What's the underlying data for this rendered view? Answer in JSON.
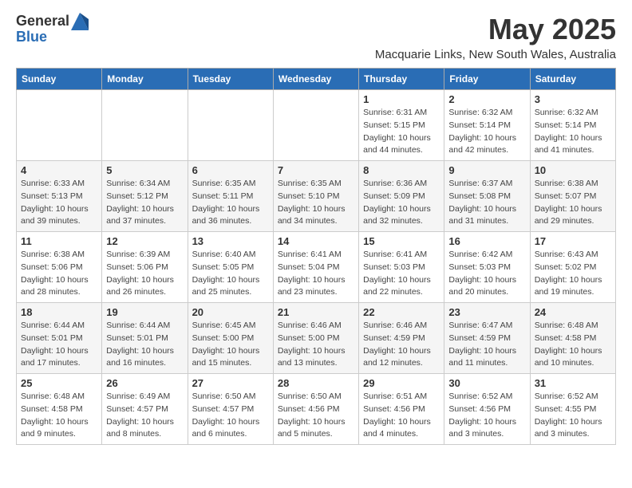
{
  "header": {
    "logo_line1": "General",
    "logo_line2": "Blue",
    "title": "May 2025",
    "subtitle": "Macquarie Links, New South Wales, Australia"
  },
  "days_of_week": [
    "Sunday",
    "Monday",
    "Tuesday",
    "Wednesday",
    "Thursday",
    "Friday",
    "Saturday"
  ],
  "weeks": [
    [
      {
        "day": "",
        "info": ""
      },
      {
        "day": "",
        "info": ""
      },
      {
        "day": "",
        "info": ""
      },
      {
        "day": "",
        "info": ""
      },
      {
        "day": "1",
        "info": "Sunrise: 6:31 AM\nSunset: 5:15 PM\nDaylight: 10 hours\nand 44 minutes."
      },
      {
        "day": "2",
        "info": "Sunrise: 6:32 AM\nSunset: 5:14 PM\nDaylight: 10 hours\nand 42 minutes."
      },
      {
        "day": "3",
        "info": "Sunrise: 6:32 AM\nSunset: 5:14 PM\nDaylight: 10 hours\nand 41 minutes."
      }
    ],
    [
      {
        "day": "4",
        "info": "Sunrise: 6:33 AM\nSunset: 5:13 PM\nDaylight: 10 hours\nand 39 minutes."
      },
      {
        "day": "5",
        "info": "Sunrise: 6:34 AM\nSunset: 5:12 PM\nDaylight: 10 hours\nand 37 minutes."
      },
      {
        "day": "6",
        "info": "Sunrise: 6:35 AM\nSunset: 5:11 PM\nDaylight: 10 hours\nand 36 minutes."
      },
      {
        "day": "7",
        "info": "Sunrise: 6:35 AM\nSunset: 5:10 PM\nDaylight: 10 hours\nand 34 minutes."
      },
      {
        "day": "8",
        "info": "Sunrise: 6:36 AM\nSunset: 5:09 PM\nDaylight: 10 hours\nand 32 minutes."
      },
      {
        "day": "9",
        "info": "Sunrise: 6:37 AM\nSunset: 5:08 PM\nDaylight: 10 hours\nand 31 minutes."
      },
      {
        "day": "10",
        "info": "Sunrise: 6:38 AM\nSunset: 5:07 PM\nDaylight: 10 hours\nand 29 minutes."
      }
    ],
    [
      {
        "day": "11",
        "info": "Sunrise: 6:38 AM\nSunset: 5:06 PM\nDaylight: 10 hours\nand 28 minutes."
      },
      {
        "day": "12",
        "info": "Sunrise: 6:39 AM\nSunset: 5:06 PM\nDaylight: 10 hours\nand 26 minutes."
      },
      {
        "day": "13",
        "info": "Sunrise: 6:40 AM\nSunset: 5:05 PM\nDaylight: 10 hours\nand 25 minutes."
      },
      {
        "day": "14",
        "info": "Sunrise: 6:41 AM\nSunset: 5:04 PM\nDaylight: 10 hours\nand 23 minutes."
      },
      {
        "day": "15",
        "info": "Sunrise: 6:41 AM\nSunset: 5:03 PM\nDaylight: 10 hours\nand 22 minutes."
      },
      {
        "day": "16",
        "info": "Sunrise: 6:42 AM\nSunset: 5:03 PM\nDaylight: 10 hours\nand 20 minutes."
      },
      {
        "day": "17",
        "info": "Sunrise: 6:43 AM\nSunset: 5:02 PM\nDaylight: 10 hours\nand 19 minutes."
      }
    ],
    [
      {
        "day": "18",
        "info": "Sunrise: 6:44 AM\nSunset: 5:01 PM\nDaylight: 10 hours\nand 17 minutes."
      },
      {
        "day": "19",
        "info": "Sunrise: 6:44 AM\nSunset: 5:01 PM\nDaylight: 10 hours\nand 16 minutes."
      },
      {
        "day": "20",
        "info": "Sunrise: 6:45 AM\nSunset: 5:00 PM\nDaylight: 10 hours\nand 15 minutes."
      },
      {
        "day": "21",
        "info": "Sunrise: 6:46 AM\nSunset: 5:00 PM\nDaylight: 10 hours\nand 13 minutes."
      },
      {
        "day": "22",
        "info": "Sunrise: 6:46 AM\nSunset: 4:59 PM\nDaylight: 10 hours\nand 12 minutes."
      },
      {
        "day": "23",
        "info": "Sunrise: 6:47 AM\nSunset: 4:59 PM\nDaylight: 10 hours\nand 11 minutes."
      },
      {
        "day": "24",
        "info": "Sunrise: 6:48 AM\nSunset: 4:58 PM\nDaylight: 10 hours\nand 10 minutes."
      }
    ],
    [
      {
        "day": "25",
        "info": "Sunrise: 6:48 AM\nSunset: 4:58 PM\nDaylight: 10 hours\nand 9 minutes."
      },
      {
        "day": "26",
        "info": "Sunrise: 6:49 AM\nSunset: 4:57 PM\nDaylight: 10 hours\nand 8 minutes."
      },
      {
        "day": "27",
        "info": "Sunrise: 6:50 AM\nSunset: 4:57 PM\nDaylight: 10 hours\nand 6 minutes."
      },
      {
        "day": "28",
        "info": "Sunrise: 6:50 AM\nSunset: 4:56 PM\nDaylight: 10 hours\nand 5 minutes."
      },
      {
        "day": "29",
        "info": "Sunrise: 6:51 AM\nSunset: 4:56 PM\nDaylight: 10 hours\nand 4 minutes."
      },
      {
        "day": "30",
        "info": "Sunrise: 6:52 AM\nSunset: 4:56 PM\nDaylight: 10 hours\nand 3 minutes."
      },
      {
        "day": "31",
        "info": "Sunrise: 6:52 AM\nSunset: 4:55 PM\nDaylight: 10 hours\nand 3 minutes."
      }
    ]
  ]
}
